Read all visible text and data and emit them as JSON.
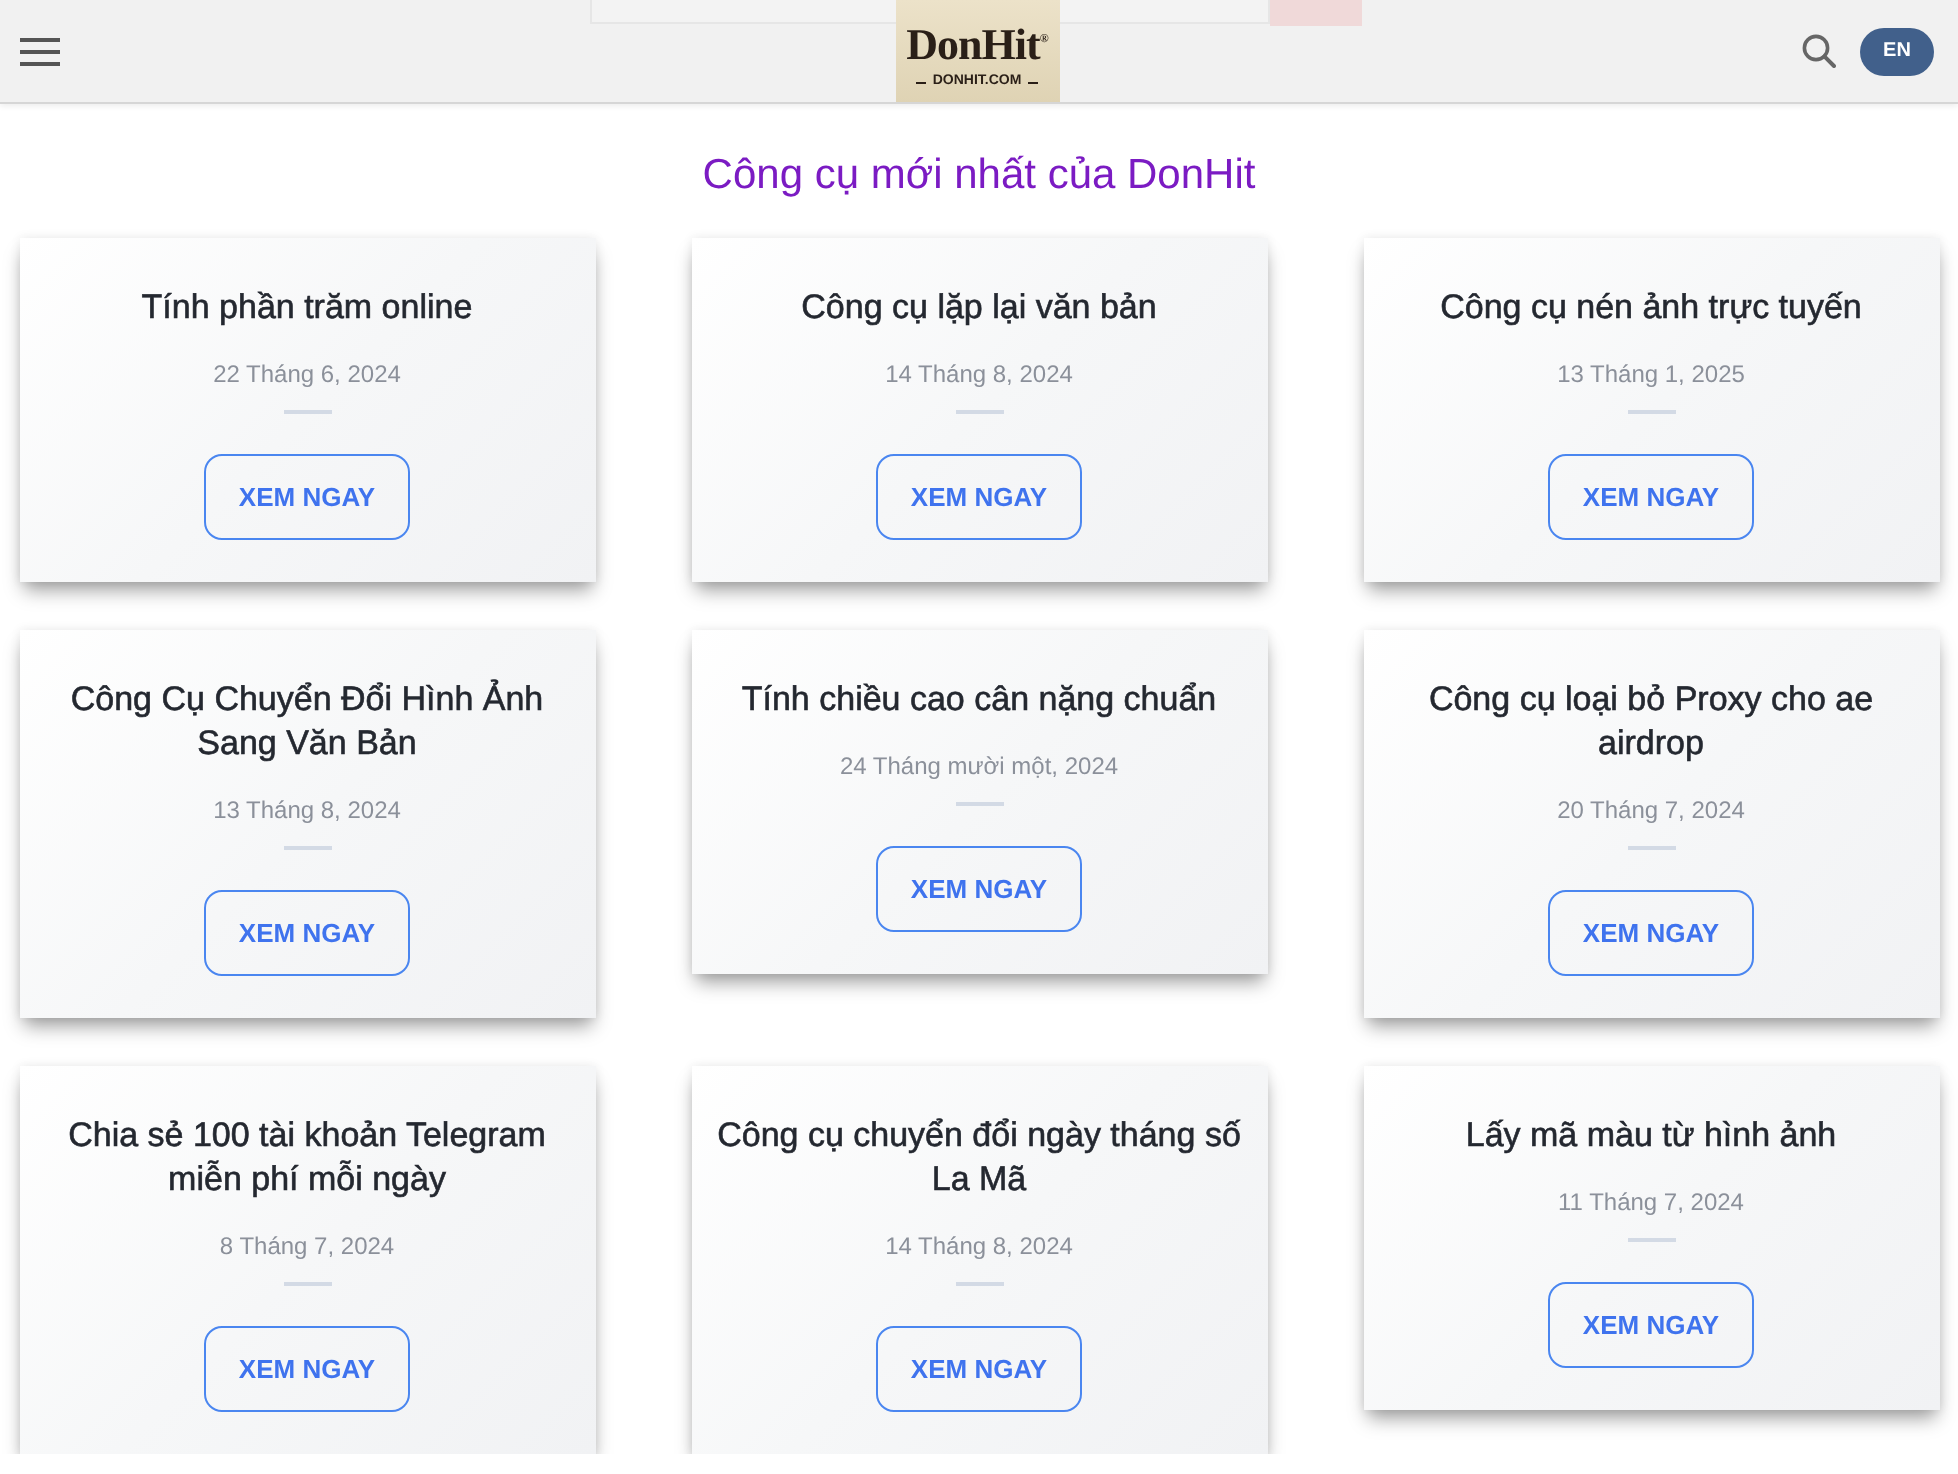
{
  "header": {
    "logo": {
      "title": "DonHit$^{®}$",
      "subtitle": "DONHIT.COM"
    },
    "language": "EN"
  },
  "heading": "Công cụ mới nhất của DonHit",
  "cards": [
    {
      "title": "Tính phần trăm online",
      "date": "22 Tháng 6, 2024",
      "button": "XEM NGAY"
    },
    {
      "title": "Công cụ lặp lại văn bản",
      "date": "14 Tháng 8, 2024",
      "button": "XEM NGAY"
    },
    {
      "title": "Công cụ nén ảnh trực tuyến",
      "date": "13 Tháng 1, 2025",
      "button": "XEM NGAY"
    },
    {
      "title": "Công Cụ Chuyển Đổi Hình Ảnh Sang Văn Bản",
      "date": "13 Tháng 8, 2024",
      "button": "XEM NGAY"
    },
    {
      "title": "Tính chiều cao cân nặng chuẩn",
      "date": "24 Tháng mười một, 2024",
      "button": "XEM NGAY"
    },
    {
      "title": "Công cụ loại bỏ Proxy cho ae airdrop",
      "date": "20 Tháng 7, 2024",
      "button": "XEM NGAY"
    },
    {
      "title": "Chia sẻ 100 tài khoản Telegram miễn phí mỗi ngày",
      "date": "8 Tháng 7, 2024",
      "button": "XEM NGAY"
    },
    {
      "title": "Công cụ chuyển đổi ngày tháng số La Mã",
      "date": "14 Tháng 8, 2024",
      "button": "XEM NGAY"
    },
    {
      "title": "Lấy mã màu từ hình ảnh",
      "date": "11 Tháng 7, 2024",
      "button": "XEM NGAY"
    }
  ]
}
